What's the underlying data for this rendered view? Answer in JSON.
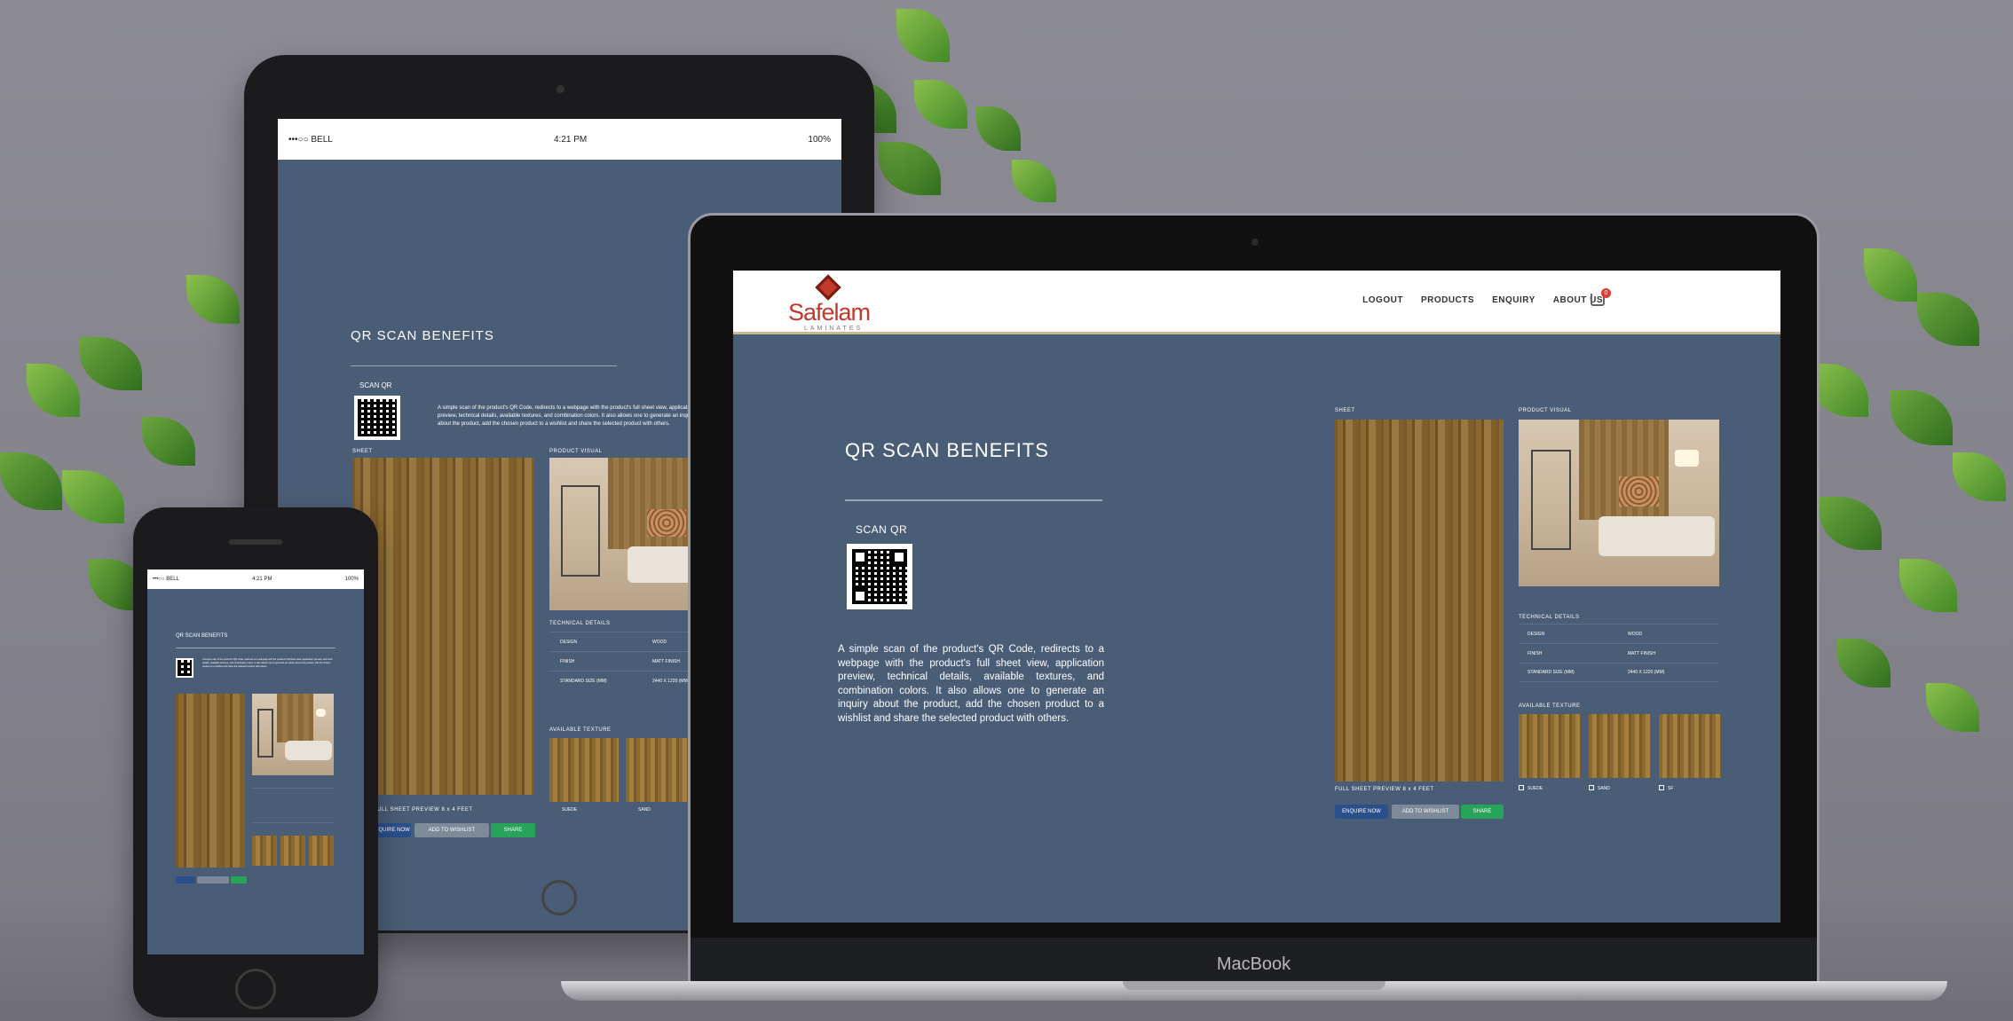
{
  "device_brand": "MacBook",
  "status_bar": {
    "carrier": "•••○○ BELL",
    "time": "4:21 PM",
    "battery": "100%"
  },
  "site": {
    "logo_text": "Safelam",
    "logo_sub": "LAMINATES",
    "nav": [
      "LOGOUT",
      "PRODUCTS",
      "ENQUIRY",
      "ABOUT US"
    ],
    "cart_count": "0"
  },
  "qr": {
    "title": "QR SCAN BENEFITS",
    "scan_label": "SCAN QR",
    "description": "A simple scan of the product's QR Code, redirects to a webpage with the product's full sheet view, application preview, technical details, available textures, and combination colors. It also allows one to generate an inquiry about the product, add the chosen product to a wishlist and share the selected product with others."
  },
  "product": {
    "sheet_label": "SHEET",
    "visual_label": "PRODUCT VISUAL",
    "tech_label": "TECHNICAL DETAILS",
    "tech_rows": [
      {
        "k": "DESIGN",
        "v": "WOOD"
      },
      {
        "k": "FINISH",
        "v": "MATT FINISH"
      },
      {
        "k": "STANDARD SIZE (MM)",
        "v": "2440 X 1220 (MM)"
      }
    ],
    "textures_label": "AVAILABLE TEXTURE",
    "textures": [
      "SUEDE",
      "SAND",
      "SF"
    ],
    "preview_caption": "FULL SHEET PREVIEW 8 x 4 FEET",
    "buttons": {
      "enquire": "ENQUIRE NOW",
      "wishlist": "ADD TO WISHLIST",
      "share": "SHARE"
    }
  }
}
